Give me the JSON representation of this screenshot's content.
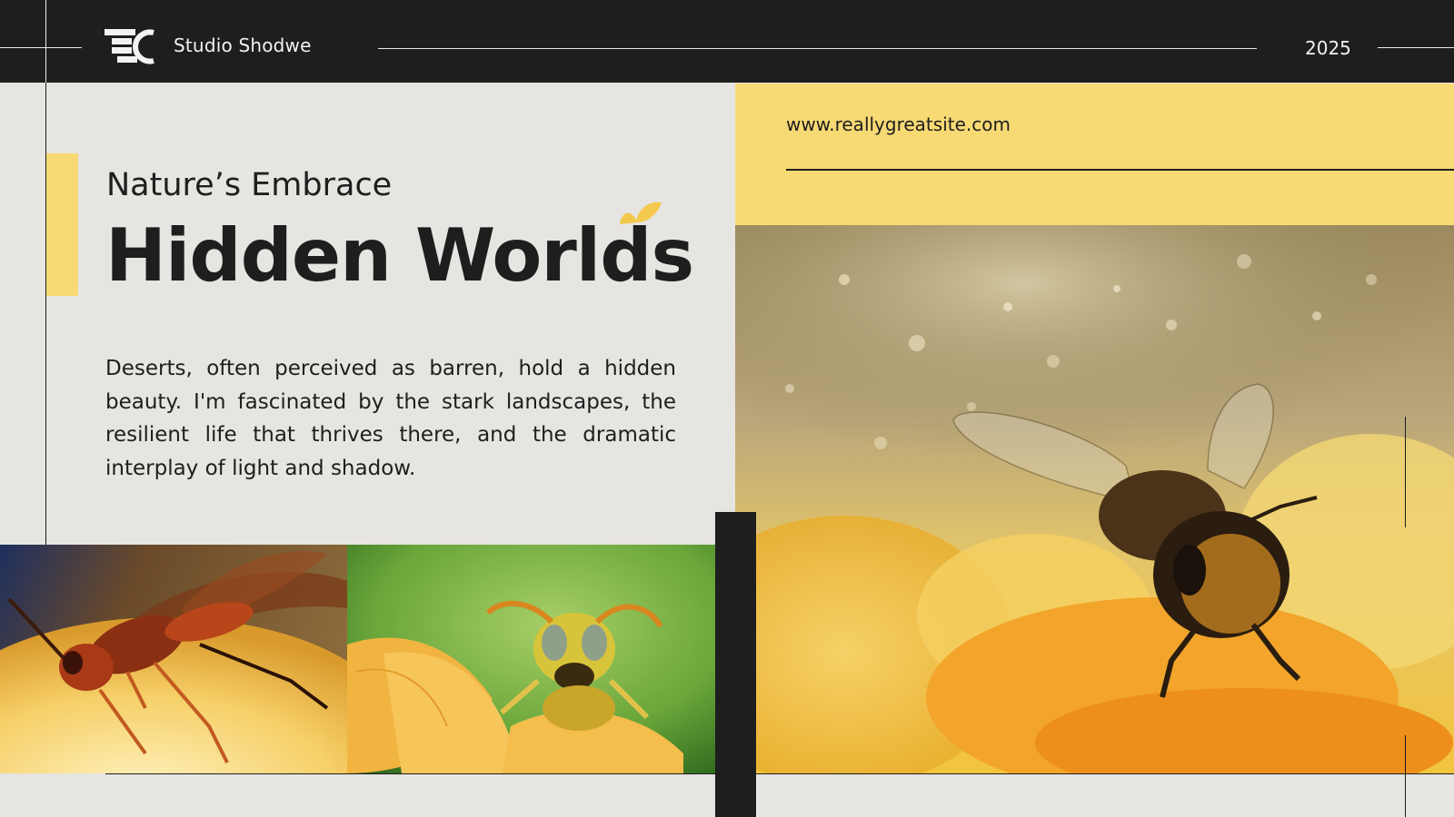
{
  "header": {
    "brand_name": "Studio Shodwe",
    "year": "2025"
  },
  "hero": {
    "subtitle": "Nature’s Embrace",
    "title": "Hidden Worlds",
    "description": "Deserts, often perceived as barren, hold a hidden beauty. I'm fascinated by the stark landscapes, the resilient life that thrives there, and the dramatic interplay of light and shadow."
  },
  "panel": {
    "website": "www.reallygreatsite.com"
  },
  "icons": {
    "logo": "studio-logo-icon",
    "leaf": "leaf-icon"
  },
  "colors": {
    "accent_yellow": "#f8da74",
    "dark": "#1e1e1e",
    "background": "#e6e5e1"
  }
}
